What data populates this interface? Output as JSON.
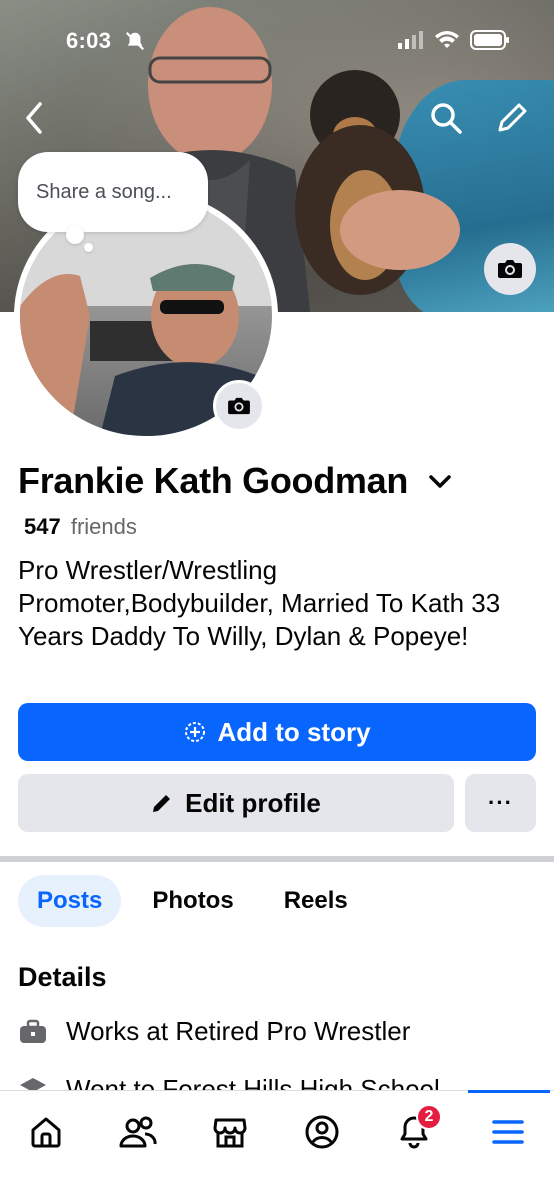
{
  "status_bar": {
    "time": "6:03"
  },
  "note": {
    "placeholder": "Share a song..."
  },
  "profile": {
    "name": "Frankie Kath Goodman",
    "friends_count": "547",
    "friends_label": "friends",
    "bio": "Pro Wrestler/Wrestling Promoter,Bodybuilder, Married To Kath 33 Years Daddy To Willy, Dylan & Popeye!"
  },
  "actions": {
    "add_to_story": "Add to story",
    "edit_profile": "Edit profile",
    "more": "···"
  },
  "tabs": [
    {
      "label": "Posts",
      "active": true
    },
    {
      "label": "Photos",
      "active": false
    },
    {
      "label": "Reels",
      "active": false
    }
  ],
  "details": {
    "title": "Details",
    "items": [
      {
        "icon": "briefcase-icon",
        "text": "Works at Retired Pro Wrestler"
      },
      {
        "icon": "graduation-cap-icon",
        "text": "Went to Forest Hills High School"
      }
    ]
  },
  "bottom_nav": {
    "items": [
      "home-icon",
      "friends-icon",
      "marketplace-icon",
      "profile-icon",
      "notifications-icon",
      "menu-icon"
    ],
    "notifications_badge": "2",
    "active": "menu-icon"
  },
  "colors": {
    "accent": "#0866ff",
    "button_gray": "#e4e6eb",
    "badge_red": "#e41e3f",
    "tab_active_bg": "#e7f0fd"
  }
}
